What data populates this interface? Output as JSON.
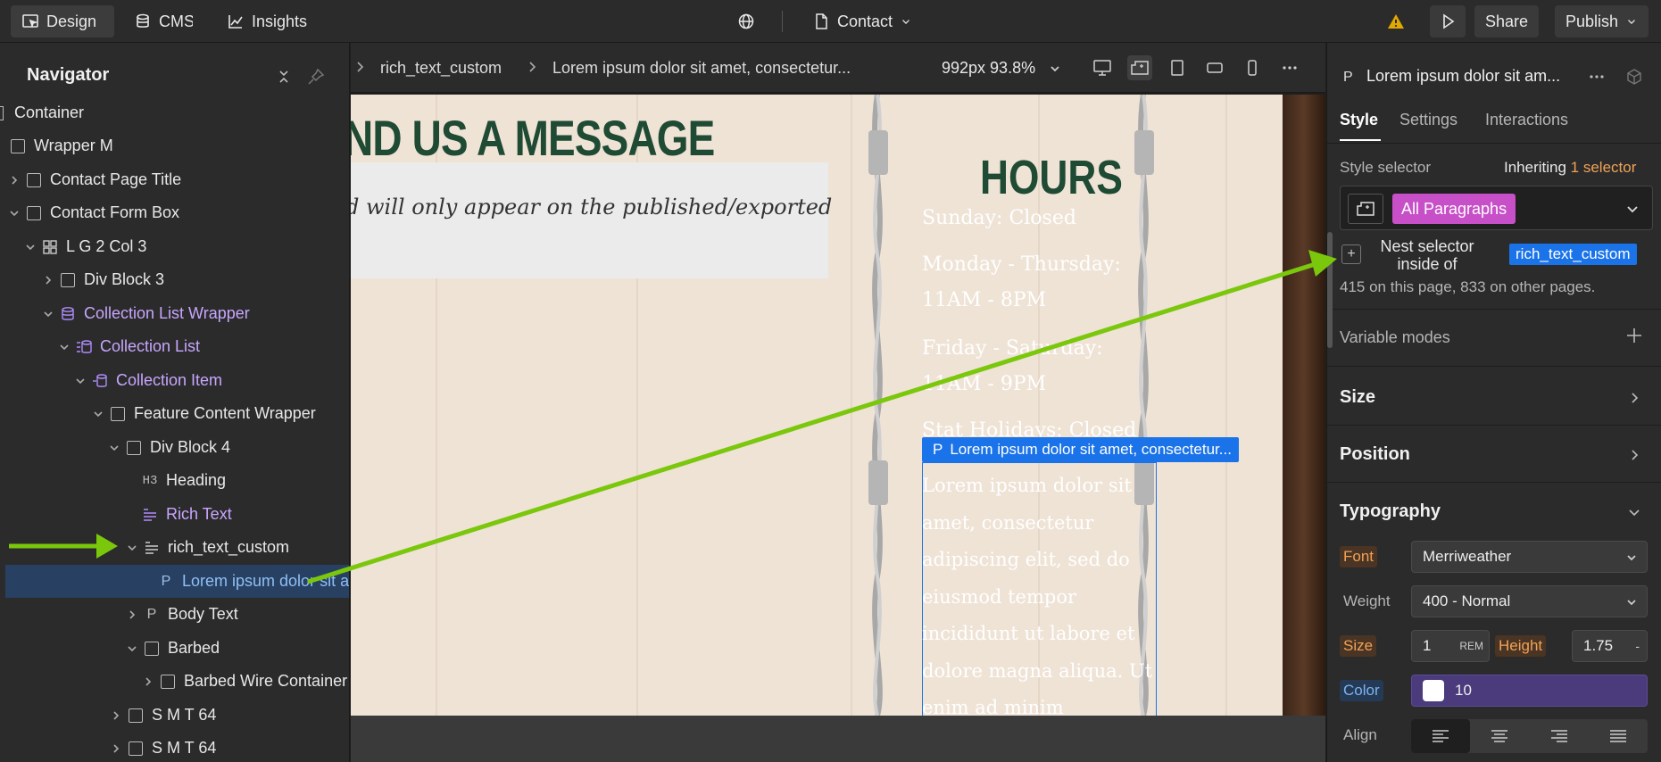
{
  "topbar": {
    "design_label": "Design",
    "cms_label": "CMS",
    "insights_label": "Insights",
    "page_label": "Contact",
    "share_label": "Share",
    "publish_label": "Publish"
  },
  "navigator": {
    "title": "Navigator",
    "rows": [
      {
        "label": "Container"
      },
      {
        "label": "Wrapper M"
      },
      {
        "label": "Contact Page Title"
      },
      {
        "label": "Contact Form Box"
      },
      {
        "label": "L G 2 Col 3"
      },
      {
        "label": "Div Block 3"
      },
      {
        "label": "Collection List Wrapper"
      },
      {
        "label": "Collection List"
      },
      {
        "label": "Collection Item"
      },
      {
        "label": "Feature Content Wrapper"
      },
      {
        "label": "Div Block 4"
      },
      {
        "label": "Heading"
      },
      {
        "label": "Rich Text"
      },
      {
        "label": "rich_text_custom"
      },
      {
        "label": "Lorem ipsum dolor sit a"
      },
      {
        "label": "Body Text"
      },
      {
        "label": "Barbed"
      },
      {
        "label": "Barbed Wire Container"
      },
      {
        "label": "S M T 64"
      },
      {
        "label": "S M T 64"
      }
    ]
  },
  "canvas_toolbar": {
    "breadcrumb": [
      "rich_text_custom",
      "Lorem ipsum dolor sit amet, consectetur..."
    ],
    "viewport": "992px 93.8%"
  },
  "canvas": {
    "send_heading": "ND US A MESSAGE",
    "message_text": "d will only appear on the published/exported",
    "hours_heading": "HOURS",
    "hours_lines": [
      "Sunday: Closed",
      "Monday - Thursday:",
      "11AM - 8PM",
      "Friday - Saturday:",
      "11AM - 9PM",
      "Stat Holidays: Closed"
    ],
    "selected_label": "Lorem ipsum dolor sit amet, consectetur...",
    "selected_text": "Lorem ipsum dolor sit amet, consectetur adipiscing elit, sed do eiusmod tempor incididunt ut labore et dolore magna aliqua. Ut enim ad minim"
  },
  "panel": {
    "element_name": "Lorem ipsum dolor sit am...",
    "tabs": [
      "Style",
      "Settings",
      "Interactions"
    ],
    "style_selector_label": "Style selector",
    "inheriting_label": "Inheriting",
    "inheriting_count": "1 selector",
    "selector_tag": "All Paragraphs",
    "nest_label": "Nest selector inside of",
    "nest_class": "rich_text_custom",
    "usage_count": "415 on this page, 833 on other pages.",
    "variable_modes": "Variable modes",
    "sections": [
      "Size",
      "Position",
      "Typography"
    ],
    "typography": {
      "font_label": "Font",
      "font_value": "Merriweather",
      "weight_label": "Weight",
      "weight_value": "400 - Normal",
      "size_label": "Size",
      "size_value": "1",
      "size_unit": "REM",
      "height_label": "Height",
      "height_value": "1.75",
      "height_unit": "-",
      "color_label": "Color",
      "color_value": "10",
      "align_label": "Align"
    }
  },
  "colors": {
    "accent_blue": "#1a73e8",
    "annotation_green": "#7ac70c",
    "heading_green": "#1f4a33",
    "selector_pink": "#c74fc8"
  }
}
